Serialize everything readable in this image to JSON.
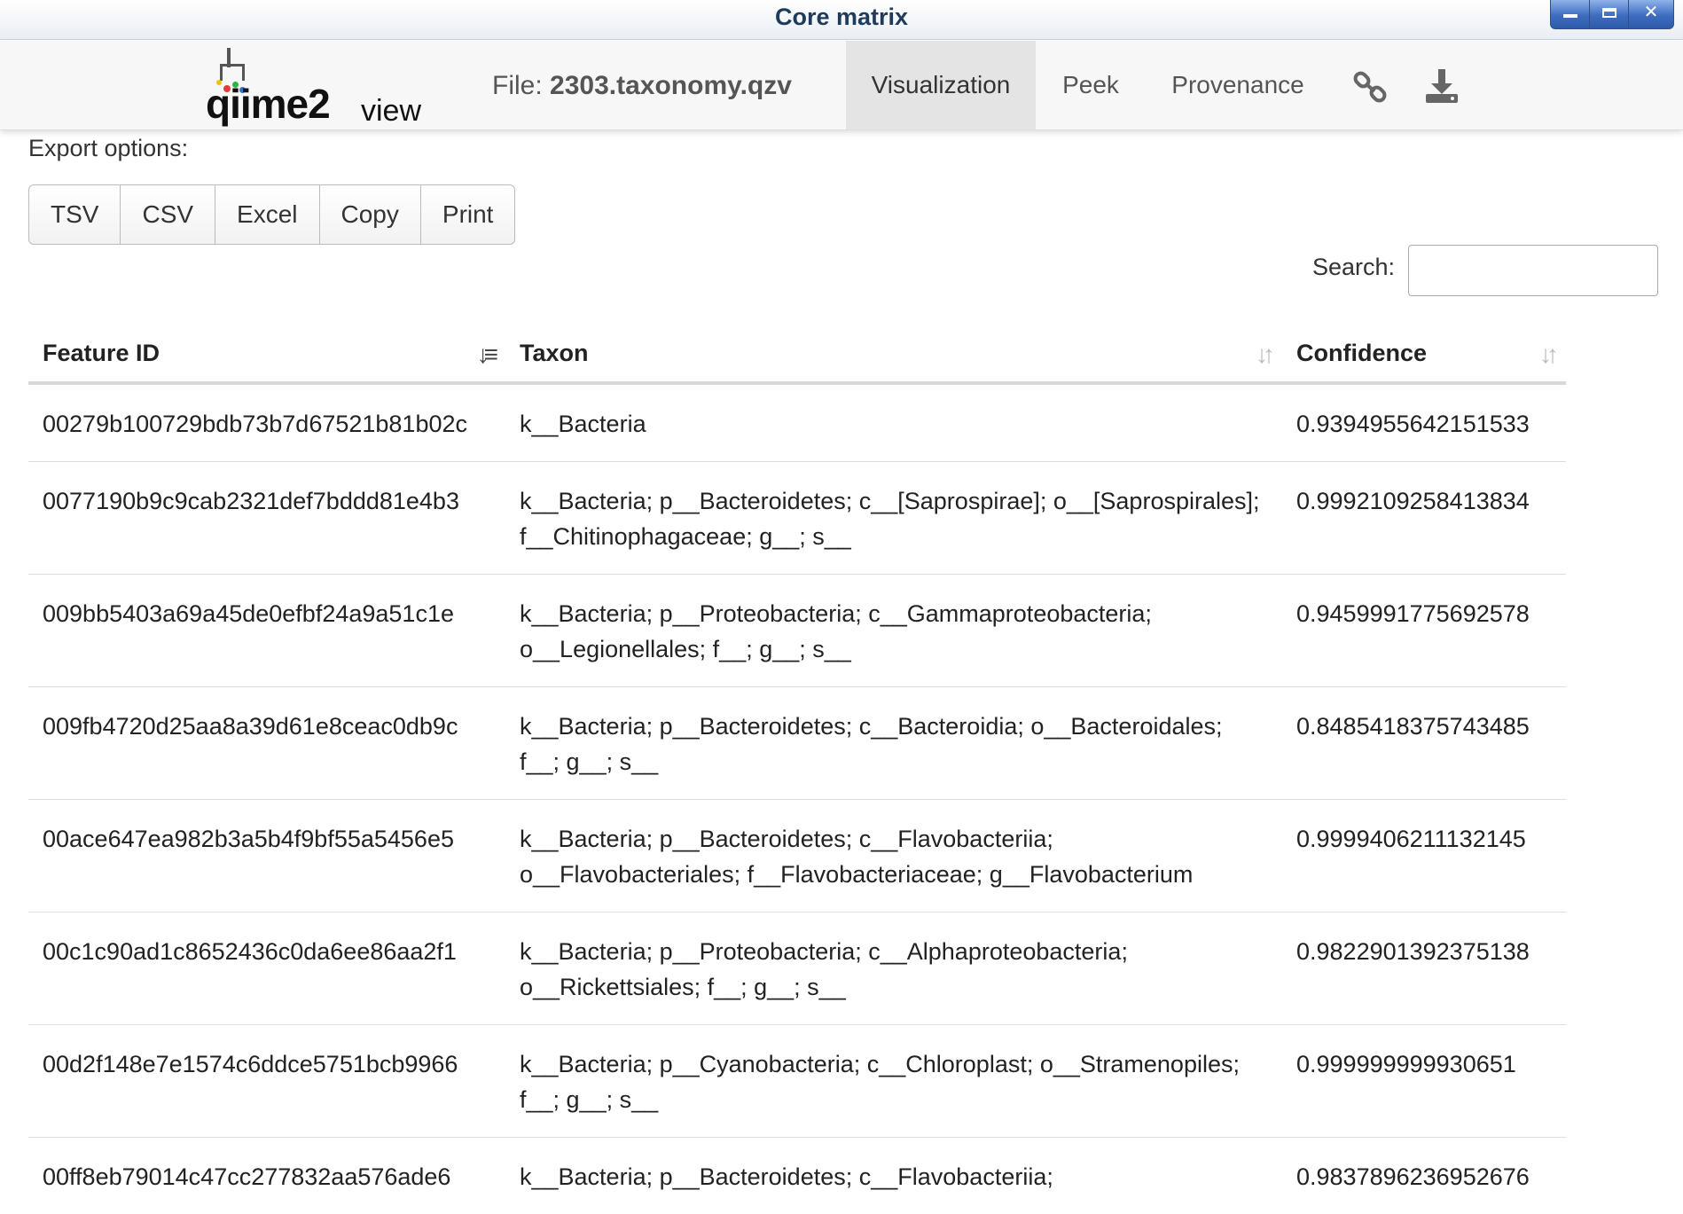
{
  "window": {
    "title": "Core matrix"
  },
  "navbar": {
    "brand_main": "qiime2",
    "brand_sub": "view",
    "file_prefix": "File:",
    "file_name": "2303.taxonomy.qzv",
    "tabs": [
      {
        "label": "Visualization",
        "active": true
      },
      {
        "label": "Peek",
        "active": false
      },
      {
        "label": "Provenance",
        "active": false
      }
    ],
    "icons": [
      "link-icon",
      "download-icon"
    ]
  },
  "export": {
    "label": "Export options:",
    "buttons": [
      "TSV",
      "CSV",
      "Excel",
      "Copy",
      "Print"
    ]
  },
  "search": {
    "label": "Search:",
    "value": "",
    "placeholder": ""
  },
  "table": {
    "columns": [
      "Feature ID",
      "Taxon",
      "Confidence"
    ],
    "sorted_column": "Feature ID",
    "rows": [
      {
        "id": "00279b100729bdb73b7d67521b81b02c",
        "taxon": "k__Bacteria",
        "confidence": "0.9394955642151533"
      },
      {
        "id": "0077190b9c9cab2321def7bddd81e4b3",
        "taxon": "k__Bacteria; p__Bacteroidetes; c__[Saprospirae]; o__[Saprospirales]; f__Chitinophagaceae; g__; s__",
        "confidence": "0.9992109258413834"
      },
      {
        "id": "009bb5403a69a45de0efbf24a9a51c1e",
        "taxon": "k__Bacteria; p__Proteobacteria; c__Gammaproteobacteria; o__Legionellales; f__; g__; s__",
        "confidence": "0.9459991775692578"
      },
      {
        "id": "009fb4720d25aa8a39d61e8ceac0db9c",
        "taxon": "k__Bacteria; p__Bacteroidetes; c__Bacteroidia; o__Bacteroidales; f__; g__; s__",
        "confidence": "0.8485418375743485"
      },
      {
        "id": "00ace647ea982b3a5b4f9bf55a5456e5",
        "taxon": "k__Bacteria; p__Bacteroidetes; c__Flavobacteriia; o__Flavobacteriales; f__Flavobacteriaceae; g__Flavobacterium",
        "confidence": "0.9999406211132145"
      },
      {
        "id": "00c1c90ad1c8652436c0da6ee86aa2f1",
        "taxon": "k__Bacteria; p__Proteobacteria; c__Alphaproteobacteria; o__Rickettsiales; f__; g__; s__",
        "confidence": "0.9822901392375138"
      },
      {
        "id": "00d2f148e7e1574c6ddce5751bcb9966",
        "taxon": "k__Bacteria; p__Cyanobacteria; c__Chloroplast; o__Stramenopiles; f__; g__; s__",
        "confidence": "0.999999999930651"
      },
      {
        "id": "00ff8eb79014c47cc277832aa576ade6",
        "taxon": "k__Bacteria; p__Bacteroidetes; c__Flavobacteriia;",
        "confidence": "0.9837896236952676"
      }
    ]
  }
}
